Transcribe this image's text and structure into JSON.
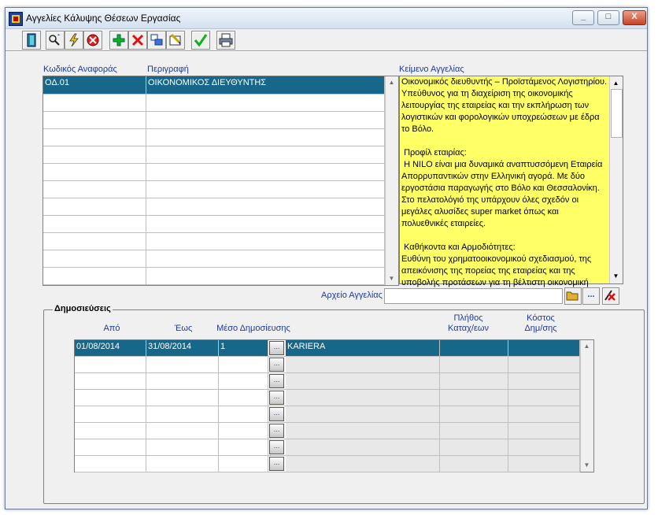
{
  "window": {
    "title": "Αγγελίες Κάλυψης Θέσεων Εργασίας",
    "minimize": "_",
    "maximize": "□",
    "close": "X"
  },
  "toolbar": {
    "buttons": [
      {
        "name": "exit-door-icon"
      },
      {
        "name": "search-icon"
      },
      {
        "name": "execute-query-icon"
      },
      {
        "name": "cancel-query-icon"
      },
      {
        "name": "insert-record-icon"
      },
      {
        "name": "delete-record-icon"
      },
      {
        "name": "duplicate-record-icon"
      },
      {
        "name": "edit-record-icon"
      },
      {
        "name": "save-checkmark-icon"
      },
      {
        "name": "print-icon"
      }
    ]
  },
  "positions": {
    "col_code": "Κωδικός Αναφοράς",
    "col_desc": "Περιγραφή",
    "rows": [
      {
        "code": "ΟΔ.01",
        "desc": "ΟΙΚΟΝΟΜΙΚΟΣ ΔΙΕΥΘΥΝΤΗΣ"
      },
      {
        "code": "",
        "desc": ""
      },
      {
        "code": "",
        "desc": ""
      },
      {
        "code": "",
        "desc": ""
      },
      {
        "code": "",
        "desc": ""
      },
      {
        "code": "",
        "desc": ""
      },
      {
        "code": "",
        "desc": ""
      },
      {
        "code": "",
        "desc": ""
      },
      {
        "code": "",
        "desc": ""
      },
      {
        "code": "",
        "desc": ""
      },
      {
        "code": "",
        "desc": ""
      },
      {
        "code": "",
        "desc": ""
      }
    ]
  },
  "ad_text": {
    "label": "Κείμενο Αγγελίας",
    "content": "Οικονομικός διευθυντής – Προϊστάμενος Λογιστηρίου.\nΥπεύθυνος για τη διαχείριση της οικονομικής λειτουργίας της εταιρείας και την εκπλήρωση των λογιστικών και φορολογικών υποχρεώσεων με έδρα το Βόλο.\n\n Προφίλ εταιρίας:\n Η NILO είναι μια δυναμικά αναπτυσσόμενη Εταιρεία Απορρυπαντικών στην Ελληνική αγορά. Με δύο εργοστάσια παραγωγής στο Βόλο και Θεσσαλονίκη. Στο πελατολόγιό της υπάρχουν όλες σχεδόν οι μεγάλες αλυσίδες super market όπως και πολυεθνικές εταιρείες.\n\n Καθήκοντα και Αρμοδιότητες:\nΕυθύνη του χρηματοοικονομικού σχεδιασμού, της απεικόνισης της πορείας της εταιρείας και της υποβολής προτάσεων για τη βέλτιστη οικονομική"
  },
  "ad_file": {
    "label": "Αρχείο Αγγελίας",
    "value": "",
    "browse_label": "..."
  },
  "publications": {
    "legend": "Δημοσιεύσεις",
    "col_from": "Από",
    "col_to": "Έως",
    "col_medium": "Μέσο Δημοσίευσης",
    "col_count": "Πλήθος\nΚαταχ/εων",
    "col_cost": "Κόστος\nΔημ/σης",
    "ellipsis": "...",
    "rows": [
      {
        "from": "01/08/2014",
        "to": "31/08/2014",
        "medium_code": "1",
        "medium_name": "KARIERA",
        "count": "",
        "cost": ""
      },
      {
        "from": "",
        "to": "",
        "medium_code": "",
        "medium_name": "",
        "count": "",
        "cost": ""
      },
      {
        "from": "",
        "to": "",
        "medium_code": "",
        "medium_name": "",
        "count": "",
        "cost": ""
      },
      {
        "from": "",
        "to": "",
        "medium_code": "",
        "medium_name": "",
        "count": "",
        "cost": ""
      },
      {
        "from": "",
        "to": "",
        "medium_code": "",
        "medium_name": "",
        "count": "",
        "cost": ""
      },
      {
        "from": "",
        "to": "",
        "medium_code": "",
        "medium_name": "",
        "count": "",
        "cost": ""
      },
      {
        "from": "",
        "to": "",
        "medium_code": "",
        "medium_name": "",
        "count": "",
        "cost": ""
      },
      {
        "from": "",
        "to": "",
        "medium_code": "",
        "medium_name": "",
        "count": "",
        "cost": ""
      }
    ]
  },
  "colors": {
    "selected_row": "#16678a",
    "ad_text_bg": "#ffff66",
    "label_blue": "#1e3a9a"
  }
}
